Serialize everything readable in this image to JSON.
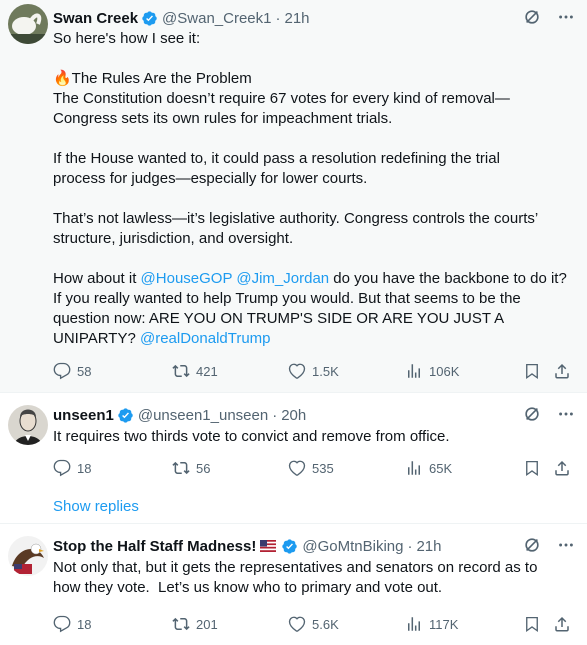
{
  "post1": {
    "name": "Swan Creek",
    "handle": "@Swan_Creek1",
    "time": "21h",
    "lines": [
      "So here's how I see it:",
      "",
      "🔥The Rules Are the Problem",
      "The Constitution doesn’t require 67 votes for every kind of removal—",
      "Congress sets its own rules for impeachment trials.",
      "",
      "If the House wanted to, it could pass a resolution redefining the trial",
      "process for judges—especially for lower courts.",
      "",
      "That’s not lawless—it’s legislative authority. Congress controls the courts’",
      "structure, jurisdiction, and oversight."
    ],
    "para_a": "How about it ",
    "mention1": "@HouseGOP",
    "space": " ",
    "mention2": "@Jim_Jordan",
    "para_b": " do you have the backbone to do it?",
    "line2": "If you really wanted to help Trump you would. But that seems to be the",
    "line3": "question now: ARE YOU ON TRUMP'S SIDE OR ARE YOU JUST A",
    "line4a": "UNIPARTY? ",
    "mention3": "@realDonaldTrump",
    "replies": "58",
    "reposts": "421",
    "likes": "1.5K",
    "views": "106K"
  },
  "post2": {
    "name": "unseen1",
    "handle": "@unseen1_unseen",
    "time": "20h",
    "text": "It requires two thirds vote to convict and remove from office.",
    "replies": "18",
    "reposts": "56",
    "likes": "535",
    "views": "65K",
    "show_replies": "Show replies"
  },
  "post3": {
    "name": "Stop the Half Staff Madness!",
    "handle": "@GoMtnBiking",
    "time": "21h",
    "line1": "Not only that, but it gets the representatives and senators on record as to",
    "line2": "how they vote.  Let’s us know who to primary and vote out.",
    "replies": "18",
    "reposts": "201",
    "likes": "5.6K",
    "views": "117K"
  },
  "separator": "·",
  "colors": {
    "link": "#1d9bf0",
    "muted": "#536471",
    "text": "#0f1419",
    "verified": "#1d9bf0"
  },
  "icons": [
    "verified-badge-icon",
    "grok-icon",
    "more-icon",
    "reply-icon",
    "repost-icon",
    "like-icon",
    "views-icon",
    "bookmark-icon",
    "share-icon",
    "us-flag-icon"
  ]
}
